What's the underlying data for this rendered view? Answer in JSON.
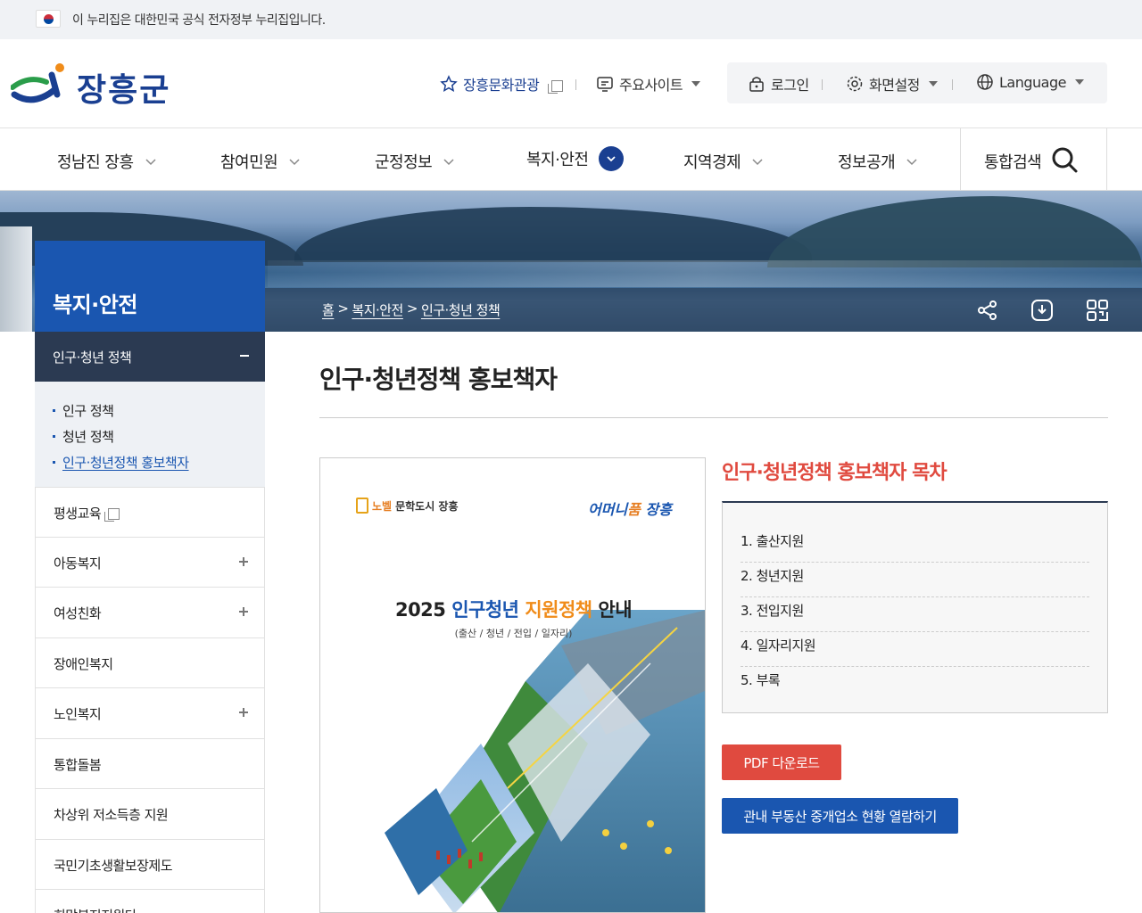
{
  "gov_banner": {
    "text": "이 누리집은 대한민국 공식 전자정부 누리집입니다."
  },
  "header": {
    "logo_text": "장흥군",
    "util": {
      "culture": "장흥문화관광",
      "sites": "주요사이트",
      "login": "로그인",
      "display": "화면설정",
      "language": "Language"
    }
  },
  "gnb": {
    "items": [
      "정남진 장흥",
      "참여민원",
      "군정정보",
      "복지·안전",
      "지역경제",
      "정보공개"
    ],
    "active_index": 3,
    "search": "통합검색"
  },
  "breadcrumb": {
    "home": "홈",
    "sep": ">",
    "level1": "복지·안전",
    "level2": "인구·청년 정책"
  },
  "lnb": {
    "title": "복지·안전",
    "open_item": "인구·청년 정책",
    "sub_items": [
      "인구 정책",
      "청년 정책",
      "인구·청년정책 홍보책자"
    ],
    "items": [
      {
        "label": "평생교육"
      },
      {
        "label": "아동복지"
      },
      {
        "label": "여성친화"
      },
      {
        "label": "장애인복지"
      },
      {
        "label": "노인복지"
      },
      {
        "label": "통합돌봄"
      },
      {
        "label": "차상위 저소득층 지원"
      },
      {
        "label": "국민기초생활보장제도"
      },
      {
        "label": "희망복지지원단"
      }
    ]
  },
  "content": {
    "page_title": "인구·청년정책 홍보책자",
    "cover": {
      "brand_left_orange": "노벨",
      "brand_left_rest": " 문학도시 장흥",
      "brand_right_a": "어머니",
      "brand_right_b": "품",
      "brand_right_c": " 장흥",
      "title_year": "2025",
      "title_blue": "인구청년",
      "title_orange": "지원정책",
      "title_rest": "안내",
      "subtitle": "(출산 / 청년 / 전입 / 일자리)"
    },
    "toc_title": "인구·청년정책 홍보책자 목차",
    "toc": [
      "1. 출산지원",
      "2. 청년지원",
      "3. 전입지원",
      "4. 일자리지원",
      "5. 부록"
    ],
    "pdf_button": "PDF 다운로드",
    "realestate_button": "관내 부동산 중개업소 현황 열람하기"
  },
  "colors": {
    "brand": "#1a3f91",
    "accent_red": "#e04a3f",
    "lnb_blue": "#1a56b0",
    "lnb_dark": "#2b3a52"
  }
}
